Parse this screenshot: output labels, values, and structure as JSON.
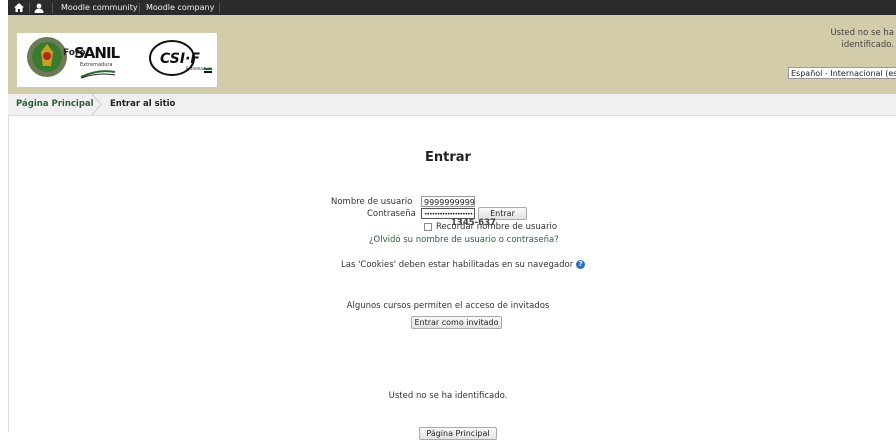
{
  "topbar": {
    "links": [
      "Moodle community",
      "Moodle company"
    ],
    "home_icon": "home-icon",
    "user_icon": "user-icon"
  },
  "header": {
    "logo_text": "SANIL",
    "logo_foro": "Foro",
    "logo_region": "Extremadura",
    "csif_text": "CSI·F",
    "csif_region": "Extremadura",
    "login_info": "Usted no se ha identificado.",
    "language": "Español - Internacional (es)"
  },
  "breadcrumb": {
    "home": "Página Principal",
    "current": "Entrar al sitio"
  },
  "login": {
    "title": "Entrar",
    "username_label": "Nombre de usuario",
    "username_value": "9999999999",
    "password_label": "Contraseña",
    "password_value": "•••••••••••••••••••",
    "submit_label": "Entrar",
    "remember_label": "Recordar nombre de usuario",
    "overlay_text": "1345-637",
    "forgot_link": "¿Olvidó su nombre de usuario o contraseña?",
    "cookies_text": "Las 'Cookies' deben estar habilitadas en su navegador",
    "guest_text": "Algunos cursos permiten el acceso de invitados",
    "guest_button": "Entrar como invitado"
  },
  "footer": {
    "status_text": "Usted no se ha identificado.",
    "home_button": "Página Principal"
  },
  "colors": {
    "header_bg": "#d2ccab",
    "topbar_bg": "#2b2b2b",
    "link": "#2d5e38",
    "help_icon": "#2f6fbd"
  }
}
